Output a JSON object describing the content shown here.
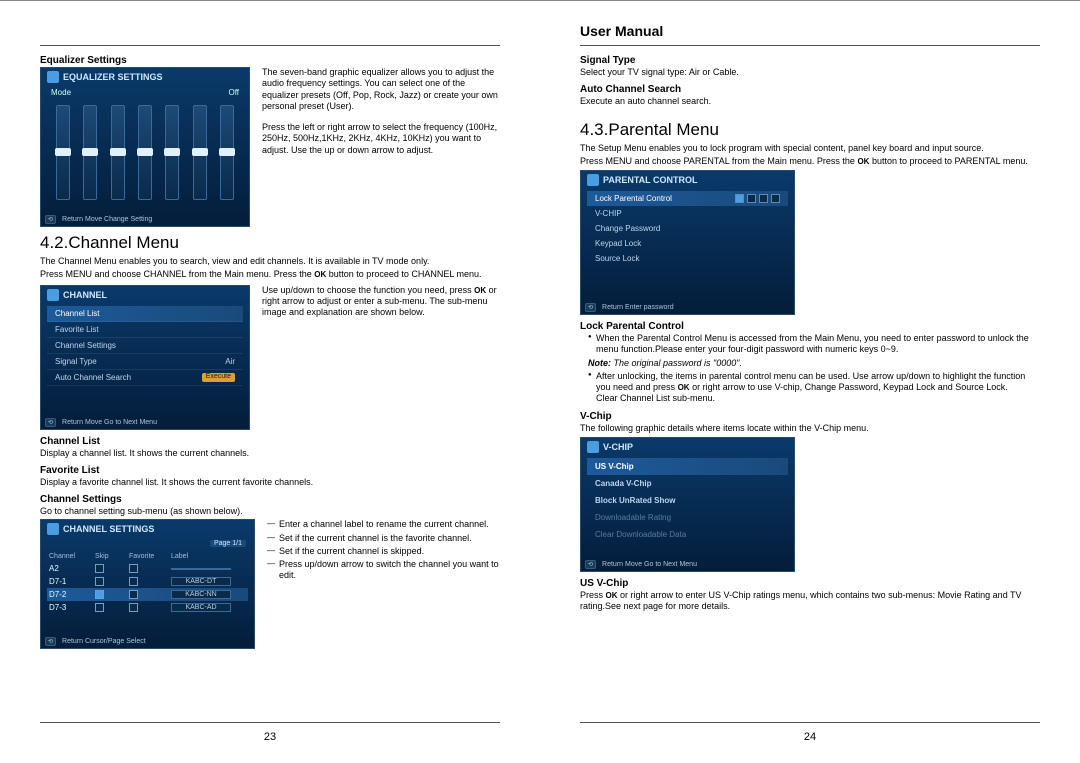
{
  "header": "User Manual",
  "pageLeft": "23",
  "pageRight": "24",
  "left": {
    "eq": {
      "h": "Equalizer Settings",
      "p1": "The seven-band graphic equalizer allows you to adjust the audio frequency settings. You can select one of the equalizer presets (Off, Pop, Rock, Jazz) or create your own personal preset (User).",
      "p2": "Press the left or right arrow to select the frequency (100Hz, 250Hz, 500Hz,1KHz, 2KHz, 4KHz, 10KHz) you want to adjust. Use the up or down arrow to adjust.",
      "tv_title": "EQUALIZER SETTINGS",
      "mode_l": "Mode",
      "mode_v": "Off",
      "foot": "Return   Move   Change Setting"
    },
    "s42": {
      "title": "4.2.Channel Menu",
      "intro1": "The Channel Menu enables you to search, view and edit channels. It is available in TV mode only.",
      "intro2a": "Press MENU and choose CHANNEL from the Main menu. Press the ",
      "intro2b": " button to proceed to CHANNEL menu.",
      "ok": "OK",
      "tv_title": "CHANNEL",
      "rows": [
        "Channel List",
        "Favorite List",
        "Channel Settings",
        "Signal Type",
        "Auto Channel Search"
      ],
      "sig_val": "Air",
      "execute": "Execute",
      "foot": "Return   Move   Go to Next Menu",
      "side1a": "Use up/down to choose the function you need, press ",
      "side1b": " or right arrow to adjust or enter a sub-menu. The sub-menu image and explanation are shown below.",
      "cl_h": "Channel List",
      "cl_p": "Display a channel list. It shows the current channels.",
      "fl_h": "Favorite List",
      "fl_p": "Display a favorite channel list. It shows the current favorite channels.",
      "cs_h": "Channel Settings",
      "cs_p": "Go to channel setting sub-menu (as shown below).",
      "cs_tv_title": "CHANNEL SETTINGS",
      "cs_page": "Page 1/1",
      "cs_cols": [
        "Channel",
        "Skip",
        "Favorite",
        "Label"
      ],
      "cs_rows": [
        {
          "ch": "A2",
          "lbl": ""
        },
        {
          "ch": "D7-1",
          "lbl": "KABC-DT"
        },
        {
          "ch": "D7-2",
          "lbl": "KABC-NN"
        },
        {
          "ch": "D7-3",
          "lbl": "KABC-AD"
        }
      ],
      "cs_foot": "Return   Cursor/Page   Select",
      "cs_side": [
        "Enter a channel label to rename the current channel.",
        "Set if the current channel is the favorite channel.",
        "Set if the current channel is skipped.",
        "Press up/down arrow to switch the channel you want to edit."
      ]
    }
  },
  "right": {
    "st_h": "Signal Type",
    "st_p": "Select your TV signal type: Air or Cable.",
    "acs_h": "Auto Channel Search",
    "acs_p": "Execute an auto channel search.",
    "s43": {
      "title": "4.3.Parental Menu",
      "intro1": "The Setup Menu enables you to lock program with special content, panel key board and input source.",
      "intro2a": "Press MENU and choose PARENTAL from the Main menu. Press the ",
      "intro2b": " button to proceed to PARENTAL menu.",
      "ok": "OK",
      "tv_title": "PARENTAL CONTROL",
      "rows": [
        "Lock Parental Control",
        "V-CHIP",
        "Change Password",
        "Keypad Lock",
        "Source Lock"
      ],
      "foot": "Return   Enter password"
    },
    "lpc": {
      "h": "Lock Parental Control",
      "b1": "When the Parental Control Menu is accessed from the Main Menu, you need to enter password to unlock the menu function.Please enter your four-digit password with numeric keys 0~9.",
      "note_l": "Note:",
      "note_t": " The original password is \"0000\".",
      "b2a": "After unlocking, the items in parental control menu can be used. Use arrow up/down to highlight the function you need and press ",
      "b2b": " or right arrow to use V-chip, Change Password, Keypad Lock and Source Lock.",
      "b2c": "Clear Channel List sub-menu."
    },
    "vc": {
      "h": "V-Chip",
      "p": "The following graphic details where items locate within the V-Chip menu.",
      "tv_title": "V-CHIP",
      "rows": [
        "US V-Chip",
        "Canada V-Chip",
        "Block UnRated Show",
        "Downloadable Rating",
        "Clear Downloadable Data"
      ],
      "foot": "Return   Move   Go to Next Menu"
    },
    "usv": {
      "h": "US V-Chip",
      "p1a": "Press ",
      "p1b": " or right arrow to enter US V-Chip ratings menu, which contains two sub-menus: Movie Rating and TV rating.See next page for more details."
    }
  }
}
